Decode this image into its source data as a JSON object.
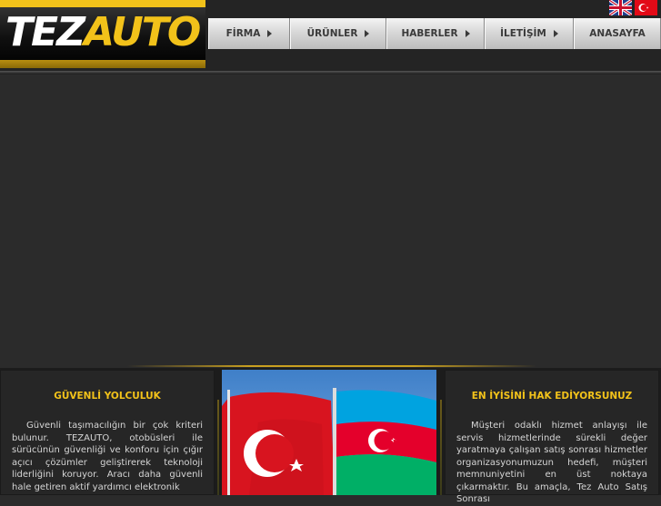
{
  "logo": {
    "text_primary": "TEZ",
    "text_accent": "AUTO"
  },
  "nav": {
    "items": [
      {
        "label": "FİRMA",
        "has_arrow": true
      },
      {
        "label": "ÜRÜNLER",
        "has_arrow": true
      },
      {
        "label": "HABERLER",
        "has_arrow": true
      },
      {
        "label": "İLETİŞİM",
        "has_arrow": true
      },
      {
        "label": "ANASAYFA",
        "has_arrow": false
      }
    ]
  },
  "languages": [
    {
      "icon": "uk-flag-icon"
    },
    {
      "icon": "turkey-flag-icon"
    }
  ],
  "left_box": {
    "title": "GÜVENLİ YOLCULUK",
    "body": "Güvenli taşımacılığın bir çok kriteri bulunur. TEZAUTO, otobüsleri ile sürücünün güvenliği ve konforu için çığır açıcı çözümler geliştirerek teknoloji liderliğini koruyor. Aracı daha güvenli hale getiren aktif yardımcı elektronik"
  },
  "center_image": {
    "icon": "turkey-azerbaijan-flags-image"
  },
  "right_box": {
    "title": "EN İYİSİNİ HAK EDİYORSUNUZ",
    "body": "Müşteri odaklı hizmet anlayışı ile servis hizmetlerinde sürekli değer yaratmaya çalışan satış sonrası hizmetler organizasyonumuzun hedefi, müşteri memnuniyetini en üst noktaya çıkarmaktır. Bu amaçla, Tez Auto Satış Sonrası"
  },
  "colors": {
    "accent_gold": "#f2c21a",
    "background": "#2b2b2b",
    "text_light": "#d6d6d6",
    "nav_text": "#3a3a3a"
  }
}
